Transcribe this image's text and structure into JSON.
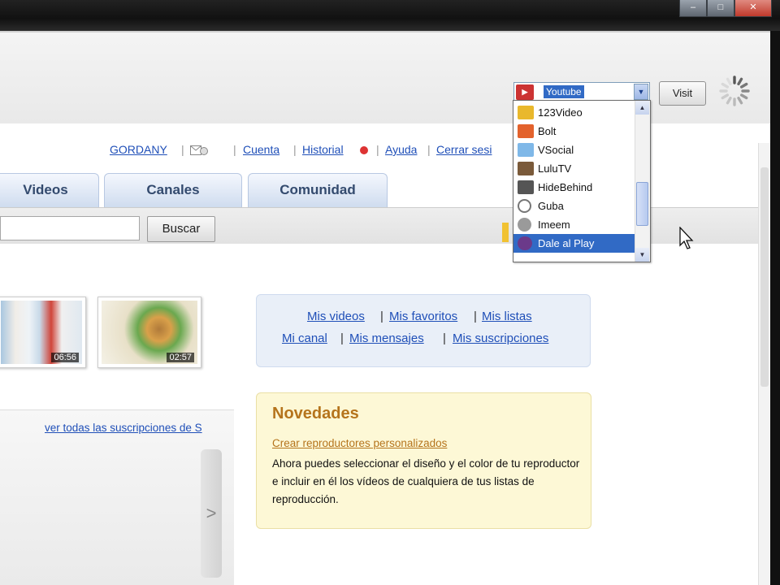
{
  "window": {
    "controls": [
      "minimize",
      "maximize",
      "close"
    ]
  },
  "toolbar": {
    "site_selector": {
      "selected": "Youtube",
      "icon": "youtube-icon",
      "options": [
        {
          "label": "123Video",
          "icon": "123video-icon",
          "color": "#e9b82c"
        },
        {
          "label": "Bolt",
          "icon": "bolt-icon",
          "color": "#e3622c"
        },
        {
          "label": "VSocial",
          "icon": "vsocial-icon",
          "color": "#7fb8e8"
        },
        {
          "label": "LuluTV",
          "icon": "lulutv-icon",
          "color": "#7a5a3a"
        },
        {
          "label": "HideBehind",
          "icon": "hidebehind-icon",
          "color": "#555555"
        },
        {
          "label": "Guba",
          "icon": "guba-icon",
          "color": "#777777"
        },
        {
          "label": "Imeem",
          "icon": "imeem-icon",
          "color": "#9a9a9a"
        },
        {
          "label": "Dale al Play",
          "icon": "dale-al-play-icon",
          "color": "#6b3a8a"
        }
      ],
      "highlighted": "Dale al Play"
    },
    "visit_label": "Visit"
  },
  "userlinks": {
    "username": "GORDANY",
    "cuenta": "Cuenta",
    "historial": "Historial",
    "ayuda": "Ayuda",
    "cerrar": "Cerrar sesi"
  },
  "tabs": {
    "videos": "Videos",
    "canales": "Canales",
    "comunidad": "Comunidad"
  },
  "search": {
    "value": "",
    "button_label": "Buscar"
  },
  "thumbnails": [
    {
      "duration": "06:56"
    },
    {
      "duration": "02:57"
    }
  ],
  "mylinks": {
    "videos": "Mis videos",
    "favoritos": "Mis favoritos",
    "listas": "Mis listas",
    "canal": "Mi canal",
    "mensajes": "Mis mensajes",
    "suscripciones": "Mis suscripciones",
    "separator": "|"
  },
  "news": {
    "title": "Novedades",
    "link": "Crear reproductores personalizados",
    "text": "Ahora puedes seleccionar el diseño y el color de tu reproductor e incluir en él los vídeos de cualquiera de tus listas de reproducción."
  },
  "subscriptions": {
    "link": "ver todas las suscripciones de S",
    "next_glyph": ">"
  },
  "colors": {
    "link": "#1f4fb8",
    "news_accent": "#b5741c",
    "selection": "#316ac5"
  }
}
